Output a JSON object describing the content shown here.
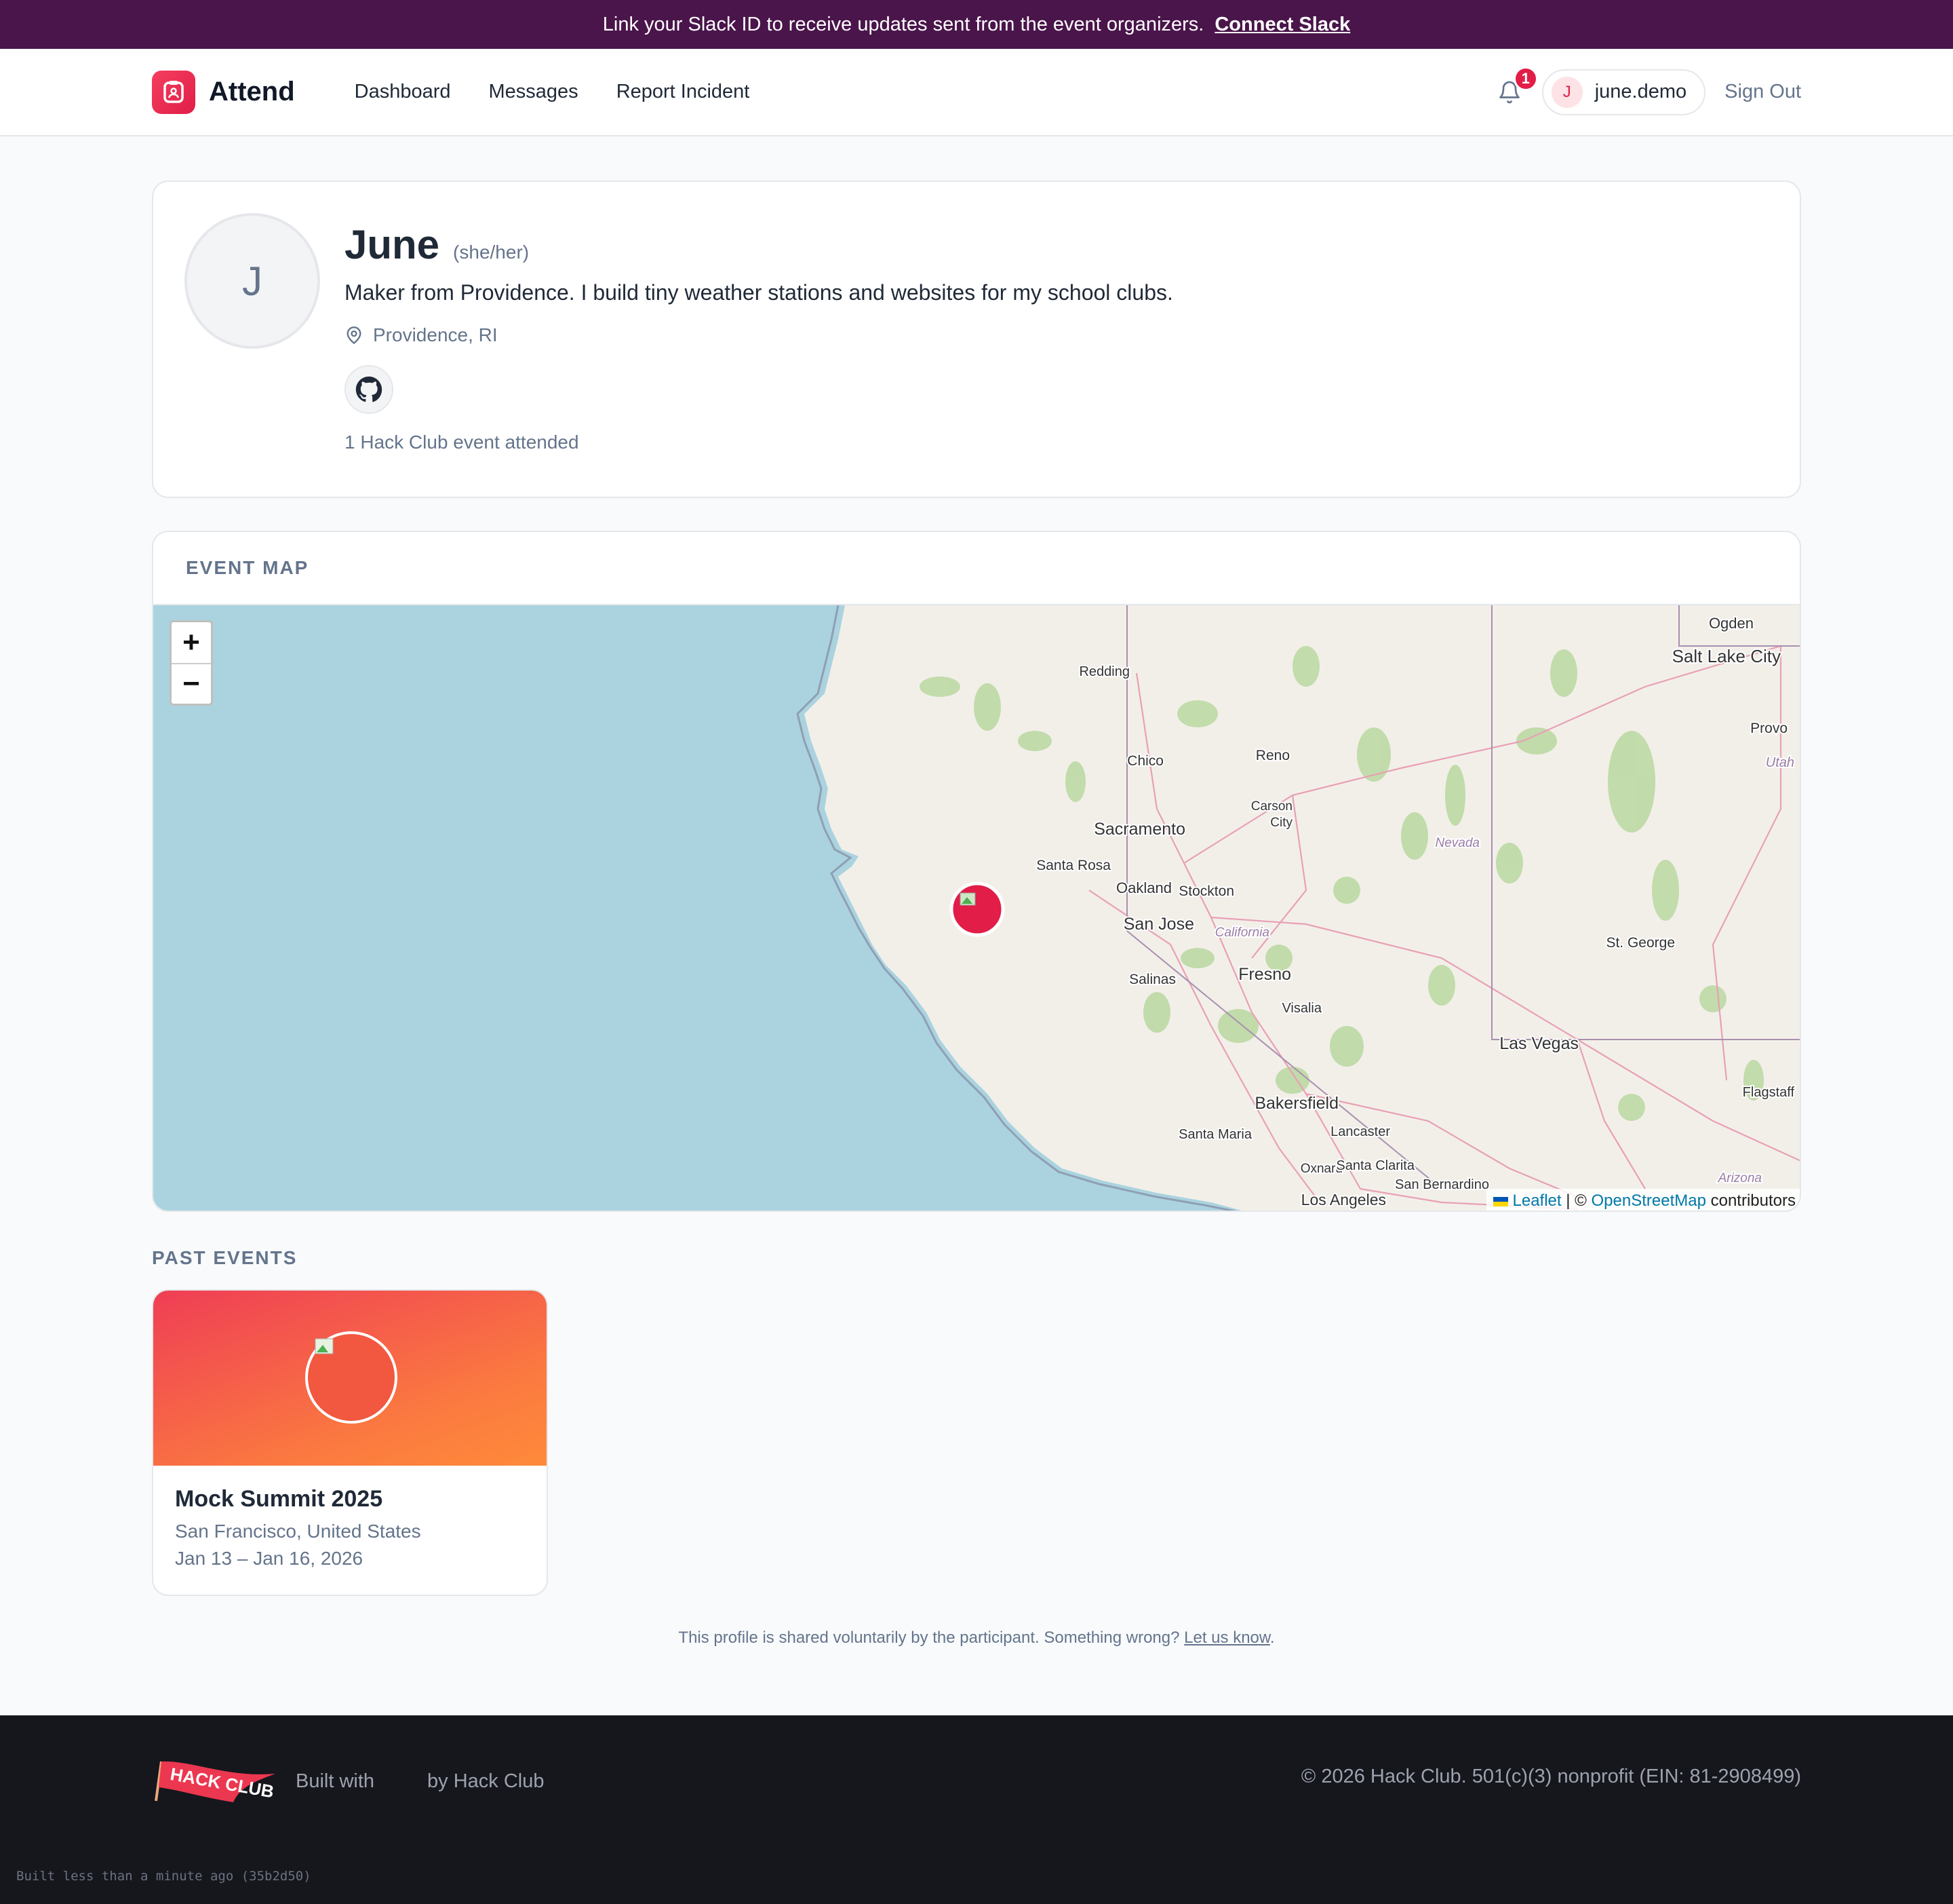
{
  "banner": {
    "text": "Link your Slack ID to receive updates sent from the event organizers.",
    "link": "Connect Slack"
  },
  "nav": {
    "brand": "Attend",
    "links": [
      "Dashboard",
      "Messages",
      "Report Incident"
    ],
    "notification_count": "1",
    "user_initial": "J",
    "username": "june.demo",
    "sign_out": "Sign Out"
  },
  "profile": {
    "initial": "J",
    "name": "June",
    "pronouns": "(she/her)",
    "bio": "Maker from Providence. I build tiny weather stations and websites for my school clubs.",
    "location": "Providence, RI",
    "attended": "1 Hack Club event attended"
  },
  "map": {
    "title": "EVENT MAP",
    "zoom_in": "+",
    "zoom_out": "−",
    "attribution_leaflet": "Leaflet",
    "attribution_sep": " | © ",
    "attribution_osm": "OpenStreetMap",
    "attribution_suffix": " contributors",
    "ocean_color": "#aad3df",
    "land_color": "#f2efe9",
    "labels": [
      {
        "text": "Ogden"
      },
      {
        "text": "Salt Lake City"
      },
      {
        "text": "Redding"
      },
      {
        "text": "Provo"
      },
      {
        "text": "Utah"
      },
      {
        "text": "Chico"
      },
      {
        "text": "Reno"
      },
      {
        "text": "Carson"
      },
      {
        "text": "City"
      },
      {
        "text": "Sacramento"
      },
      {
        "text": "Nevada"
      },
      {
        "text": "Santa Rosa"
      },
      {
        "text": "Oakland"
      },
      {
        "text": "Stockton"
      },
      {
        "text": "San Jose"
      },
      {
        "text": "California"
      },
      {
        "text": "St. George"
      },
      {
        "text": "Fresno"
      },
      {
        "text": "Salinas"
      },
      {
        "text": "Visalia"
      },
      {
        "text": "Las Vegas"
      },
      {
        "text": "Flagstaff"
      },
      {
        "text": "Bakersfield"
      },
      {
        "text": "Santa Maria"
      },
      {
        "text": "Lancaster"
      },
      {
        "text": "Oxnard"
      },
      {
        "text": "Santa Clarita"
      },
      {
        "text": "San Bernardino"
      },
      {
        "text": "Arizona"
      },
      {
        "text": "Los Angeles"
      }
    ]
  },
  "past_events": {
    "title": "PAST EVENTS",
    "items": [
      {
        "name": "Mock Summit 2025",
        "location": "San Francisco, United States",
        "dates": "Jan 13 – Jan 16, 2026"
      }
    ]
  },
  "disclaimer": {
    "text": "This profile is shared voluntarily by the participant. Something wrong?",
    "link": "Let us know"
  },
  "footer": {
    "built_with": "Built with",
    "by": "by Hack Club",
    "copyright": "© 2026 Hack Club. 501(c)(3) nonprofit (EIN: 81-2908499)",
    "build_info": "Built less than a minute ago (35b2d50)",
    "logo_text": "HACK CLUB"
  }
}
